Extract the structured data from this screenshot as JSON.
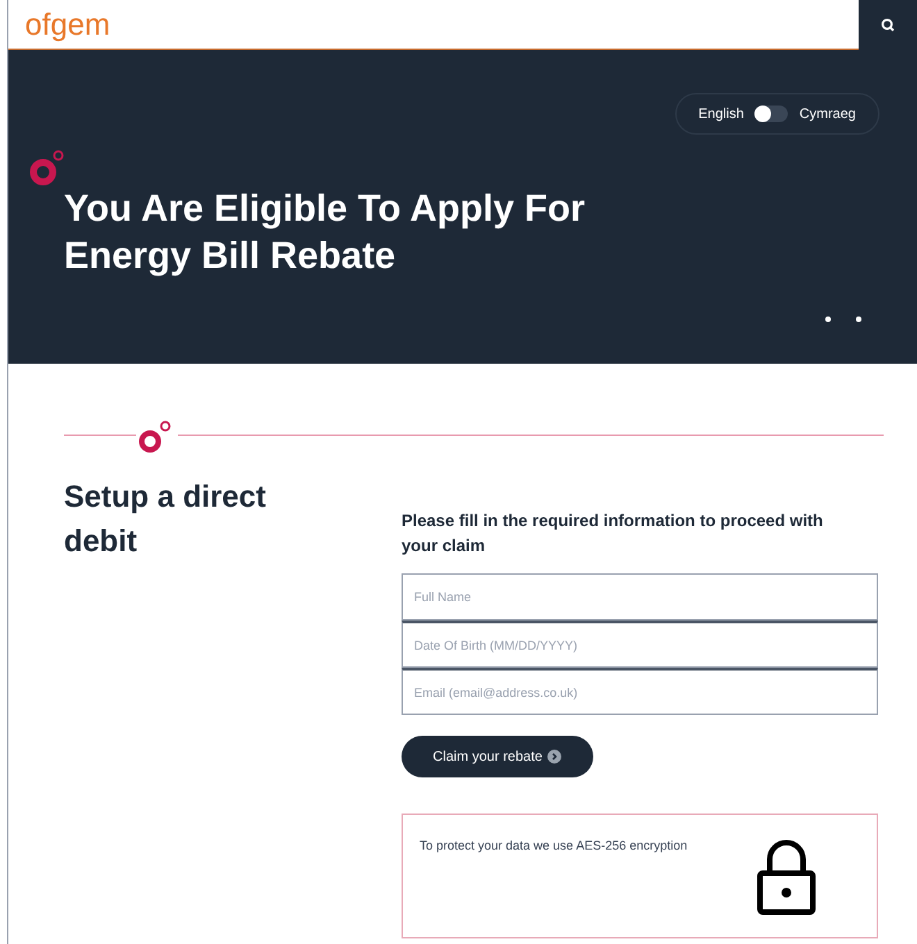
{
  "header": {
    "logo": "ofgem"
  },
  "language_toggle": {
    "left_label": "English",
    "right_label": "Cymraeg",
    "on": false
  },
  "hero": {
    "title": "You Are Eligible To Apply For Energy Bill Rebate"
  },
  "section": {
    "heading": "Setup a direct debit"
  },
  "form": {
    "intro": "Please fill in the required information to proceed with your claim",
    "fields": [
      {
        "placeholder": "Full Name"
      },
      {
        "placeholder": "Date Of Birth (MM/DD/YYYY)"
      },
      {
        "placeholder": "Email (email@address.co.uk)"
      }
    ],
    "submit": "Claim your rebate"
  },
  "notice": {
    "text": "To protect your data we use AES-256 encryption"
  }
}
